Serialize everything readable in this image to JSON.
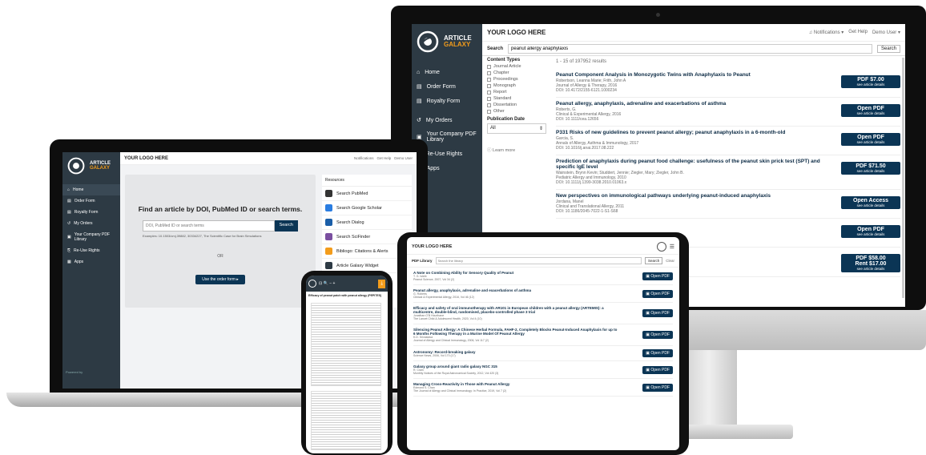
{
  "brand": {
    "line1": "ARTICLE",
    "line2": "GALAXY",
    "your_logo": "YOUR LOGO HERE"
  },
  "header": {
    "notifications": "Notifications",
    "help": "Get Help",
    "user": "Demo User"
  },
  "desktop": {
    "search_label": "Search",
    "search_value": "peanut allergy anaphylaxis",
    "search_button": "Search",
    "nav": [
      "Home",
      "Order Form",
      "Royalty Form",
      "My Orders",
      "Your Company PDF Library",
      "Re-Use Rights",
      "Apps"
    ],
    "filters": {
      "content_types_title": "Content Types",
      "content_types": [
        "Journal Article",
        "Chapter",
        "Proceedings",
        "Monograph",
        "Report",
        "Standard",
        "Dissertation",
        "Other"
      ],
      "pub_date_title": "Publication Date",
      "pub_date_value": "All",
      "learn_more": "Learn more"
    },
    "results_count": "1 - 15 of 197952 results",
    "results": [
      {
        "title": "Peanut Component Analysis in Monozygotic Twins with Anaphylaxis to Peanut",
        "authors": "Robertson, Leanna Marie; Frith, John A",
        "source": "Journal of Allergy & Therapy, 2016",
        "doi": "DOI: 10.4172/2155-6121.1000234",
        "btn1": "PDF $7.00",
        "btn2": "see article details"
      },
      {
        "title": "Peanut allergy, anaphylaxis, adrenaline and exacerbations of asthma",
        "authors": "Roberts, G.",
        "source": "Clinical & Experimental Allergy, 2016",
        "doi": "DOI: 10.1111/cea.12656",
        "btn1": "Open PDF",
        "btn2": "see article details"
      },
      {
        "title": "P331 Risks of new guidelines to prevent peanut allergy; peanut anaphylaxis in a 6-month-old",
        "authors": "Garcia, S.",
        "source": "Annals of Allergy, Asthma & Immunology, 2017",
        "doi": "DOI: 10.1016/j.anai.2017.08.222",
        "btn1": "Open PDF",
        "btn2": "see article details"
      },
      {
        "title": "Prediction of anaphylaxis during peanut food challenge: usefulness of the peanut skin prick test (SPT) and specific IgE level",
        "authors": "Wainstein, Brynn Kevin; Studdert, Jennie; Ziegler, Mary; Ziegler, John B.",
        "source": "Pediatric Allergy and Immunology, 2010",
        "doi": "DOI: 10.1111/j.1399-3038.2010.01063.x",
        "btn1": "PDF $71.50",
        "btn2": "see article details"
      },
      {
        "title": "New perspectives on immunological pathways underlying peanut-induced anaphylaxis",
        "authors": "Jordana, Manel",
        "source": "Clinical and Translational Allergy, 2011",
        "doi": "DOI: 10.1186/2045-7022-1-S1-S68",
        "btn1": "Open Access",
        "btn2": "see article details"
      },
      {
        "title": "",
        "authors": "",
        "source": "",
        "doi": "",
        "btn1": "Open PDF",
        "btn2": "see article details"
      },
      {
        "title": "blocks anaphylaxis in a murine model of peanut",
        "authors": "",
        "source": "",
        "doi": "",
        "btn1": "PDF $58.00",
        "btn1b": "Rent $17.00",
        "btn2": "see article details"
      }
    ]
  },
  "laptop": {
    "nav": [
      "Home",
      "Order Form",
      "Royalty Form",
      "My Orders",
      "Your Company PDF Library",
      "Re-Use Rights",
      "Apps"
    ],
    "find_title": "Find an article by DOI, PubMed ID or search terms.",
    "search_placeholder": "DOI, PubMed ID or search terms",
    "search_button": "Search",
    "examples": "Examples: 10.1503/cmj.39882, 30334227, The Scientific Case for Brain Simulations",
    "or": "OR",
    "order_button": "Use the order form",
    "resources_title": "Resources",
    "resources": [
      "Search PubMed",
      "Search Google Scholar",
      "Search Dialog",
      "Search SciFinder",
      "Bibliogo: Citations & Alerts",
      "Article Galaxy Widget"
    ],
    "footer": "Powered by"
  },
  "tablet": {
    "logo": "YOUR LOGO HERE",
    "tab": "PDF Library",
    "search_placeholder": "Search the library",
    "search_button": "Search",
    "clear": "Clear",
    "items": [
      {
        "title": "A Note on Combining Ability for Sensory Quality of Peanut",
        "meta": "T. G. Isleib",
        "source": "Peanut Science, 2007, Vol 34 (2)",
        "btn": "Open PDF"
      },
      {
        "title": "Peanut allergy, anaphylaxis, adrenaline and exacerbations of asthma",
        "meta": "G. Roberts",
        "source": "Clinical & Experimental Allergy, 2016, Vol 46 (12)",
        "btn": "Open PDF"
      },
      {
        "title": "Efficacy and safety of oral immunotherapy with AR101 in European children with a peanut allergy (ARTEMIS): a multicentre, double-blind, randomised, placebo-controlled phase 3 trial",
        "meta": "Jonathan O'B Hourihane",
        "source": "The Lancet Child & Adolescent Health, 2020, Vol 4 (10)",
        "btn": "Open PDF"
      },
      {
        "title": "Silencing Peanut Allergy: A Chinese Herbal Formula, FAHF-2, Completely Blocks Peanut-Induced Anaphylaxis for up to 6 Months Following Therapy in a Murine Model Of Peanut Allergy",
        "meta": "K.D. Srivastava",
        "source": "Journal of Allergy and Clinical Immunology, 2006, Vol 117 (2)",
        "btn": "Open PDF"
      },
      {
        "title": "Astronomy: Record-breaking galaxy",
        "meta": "",
        "source": "Science News, 2006, Vol 170 (17)",
        "btn": "Open PDF"
      },
      {
        "title": "Galaxy group around giant radio galaxy NGC 315",
        "meta": "R. Crain",
        "source": "Monthly Notices of the Royal Astronomical Society, 2012, Vol 420 (3)",
        "btn": "Open PDF"
      },
      {
        "title": "Managing Cross-Reactivity in Those with Peanut Allergy",
        "meta": "Edmond S. Chan",
        "source": "The Journal of Allergy and Clinical Immunology: In Practice, 2019, Vol 7 (2)",
        "btn": "Open PDF"
      }
    ]
  },
  "phone": {
    "title": "Efficacy of peanut patch with peanut allergy (PEPITES)"
  }
}
